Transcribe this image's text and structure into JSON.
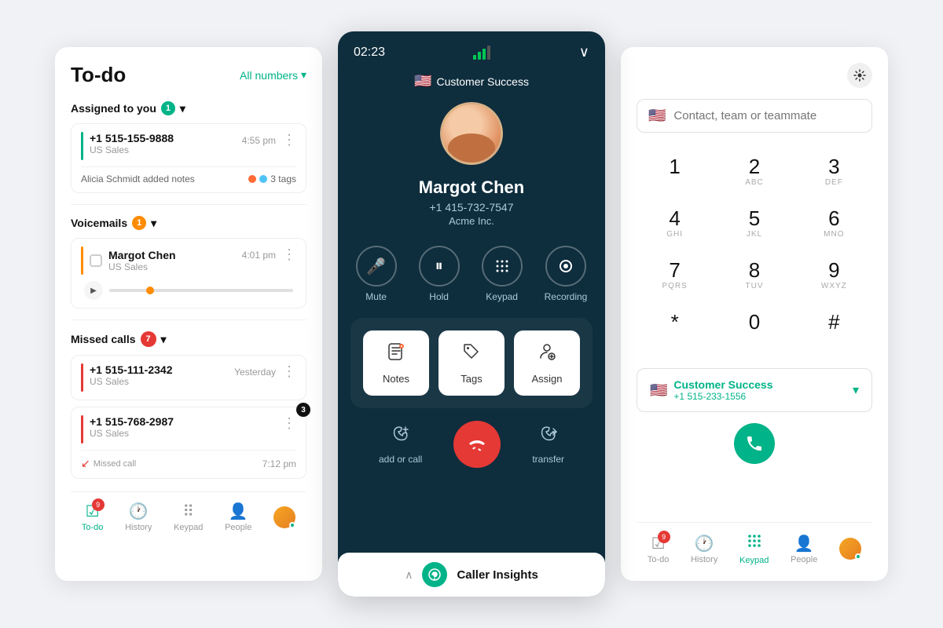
{
  "left_panel": {
    "title": "To-do",
    "all_numbers": "All numbers",
    "sections": {
      "assigned": {
        "label": "Assigned to you",
        "count": "1",
        "items": [
          {
            "phone": "+1 515-155-9888",
            "sub": "US Sales",
            "time": "4:55 pm",
            "notes": "Alicia Schmidt added notes",
            "tags_count": "3 tags"
          }
        ]
      },
      "voicemails": {
        "label": "Voicemails",
        "count": "1",
        "items": [
          {
            "name": "Margot Chen",
            "sub": "US Sales",
            "time": "4:01 pm"
          }
        ]
      },
      "missed": {
        "label": "Missed calls",
        "count": "7",
        "items": [
          {
            "phone": "+1 515-111-2342",
            "sub": "US Sales",
            "time": "Yesterday"
          },
          {
            "phone": "+1 515-768-2987",
            "sub": "US Sales",
            "time": "7:12 pm",
            "badge": "3",
            "missed_label": "Missed call"
          }
        ]
      }
    },
    "nav": {
      "todo": {
        "label": "To-do",
        "badge": "9"
      },
      "history": {
        "label": "History"
      },
      "keypad": {
        "label": "Keypad"
      },
      "people": {
        "label": "People"
      }
    }
  },
  "middle_panel": {
    "timer": "02:23",
    "team": "Customer Success",
    "caller_name": "Margot Chen",
    "caller_phone": "+1 415-732-7547",
    "caller_company": "Acme Inc.",
    "controls": [
      {
        "id": "mute",
        "label": "Mute",
        "icon": "🎤"
      },
      {
        "id": "hold",
        "label": "Hold",
        "icon": "⏸"
      },
      {
        "id": "keypad",
        "label": "Keypad",
        "icon": "⠿"
      },
      {
        "id": "recording",
        "label": "Recording",
        "icon": "⏺"
      }
    ],
    "actions": [
      {
        "id": "notes",
        "label": "Notes"
      },
      {
        "id": "tags",
        "label": "Tags"
      },
      {
        "id": "assign",
        "label": "Assign"
      }
    ],
    "bottom_actions": [
      {
        "id": "add_call",
        "label": "add or call"
      },
      {
        "id": "transfer",
        "label": "transfer"
      }
    ],
    "end_call_icon": "📞",
    "insights": {
      "label": "Caller Insights"
    }
  },
  "right_panel": {
    "search_placeholder": "Contact, team or teammate",
    "keypad_keys": [
      {
        "num": "1",
        "letters": ""
      },
      {
        "num": "2",
        "letters": "ABC"
      },
      {
        "num": "3",
        "letters": "DEF"
      },
      {
        "num": "4",
        "letters": "GHI"
      },
      {
        "num": "5",
        "letters": "JKL"
      },
      {
        "num": "6",
        "letters": "MNO"
      },
      {
        "num": "7",
        "letters": "PQRS"
      },
      {
        "num": "8",
        "letters": "TUV"
      },
      {
        "num": "9",
        "letters": "WXYZ"
      },
      {
        "num": "*",
        "letters": ""
      },
      {
        "num": "0",
        "letters": ""
      },
      {
        "num": "#",
        "letters": ""
      }
    ],
    "selected_number": {
      "name": "Customer Success",
      "phone": "+1 515-233-1556"
    },
    "nav": {
      "todo": {
        "label": "To-do",
        "badge": "9"
      },
      "history": {
        "label": "History"
      },
      "keypad": {
        "label": "Keypad",
        "active": true
      },
      "people": {
        "label": "People"
      }
    }
  }
}
